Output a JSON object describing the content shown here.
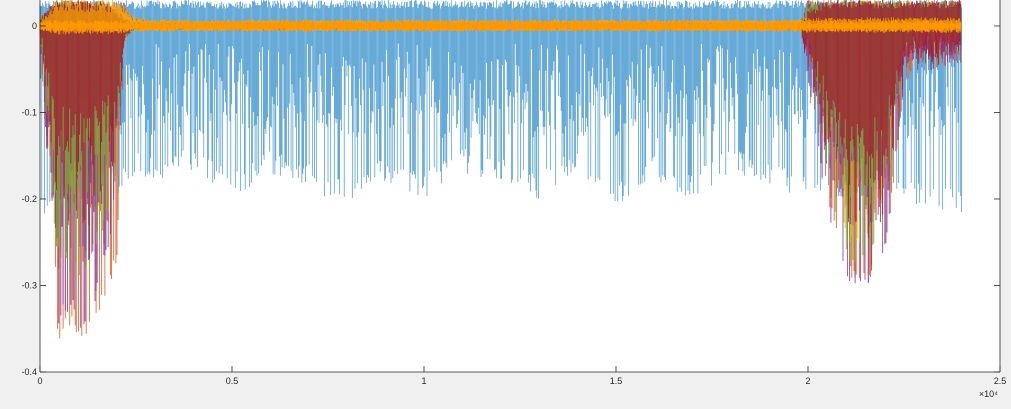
{
  "chart_data": {
    "type": "line",
    "title": "",
    "xlabel": "",
    "ylabel": "",
    "xlim": [
      0,
      25000
    ],
    "ylim": [
      -0.4,
      0.03
    ],
    "x_ticks": [
      {
        "value": 0,
        "label": "0"
      },
      {
        "value": 5000,
        "label": "0.5"
      },
      {
        "value": 10000,
        "label": "1"
      },
      {
        "value": 15000,
        "label": "1.5"
      },
      {
        "value": 20000,
        "label": "2"
      },
      {
        "value": 25000,
        "label": "2.5"
      }
    ],
    "x_exponent_label": "×10⁴",
    "y_ticks": [
      {
        "value": 0,
        "label": "0"
      },
      {
        "value": -0.1,
        "label": "-0.1"
      },
      {
        "value": -0.2,
        "label": "-0.2"
      },
      {
        "value": -0.3,
        "label": "-0.3"
      },
      {
        "value": -0.4,
        "label": "-0.4"
      }
    ],
    "grid": false,
    "legend": "none",
    "series": [
      {
        "color": "#0072bd",
        "x": [
          0,
          500,
          1000,
          1500,
          2000,
          2500,
          3000,
          4000,
          5000,
          6000,
          7000,
          8000,
          9000,
          10000,
          11000,
          12000,
          13000,
          14000,
          15000,
          16000,
          17000,
          18000,
          19000,
          20000,
          21000,
          22000,
          23000,
          24000
        ],
        "upper": [
          0.03,
          0.03,
          0.03,
          0.03,
          0.03,
          0.03,
          0.03,
          0.03,
          0.03,
          0.03,
          0.03,
          0.03,
          0.03,
          0.03,
          0.03,
          0.03,
          0.03,
          0.03,
          0.03,
          0.03,
          0.03,
          0.03,
          0.03,
          0.03,
          0.03,
          0.03,
          0.03,
          0.03
        ],
        "lower": [
          -0.23,
          -0.2,
          -0.17,
          -0.18,
          -0.2,
          -0.17,
          -0.18,
          -0.17,
          -0.2,
          -0.17,
          -0.19,
          -0.21,
          -0.18,
          -0.2,
          -0.17,
          -0.18,
          -0.2,
          -0.17,
          -0.21,
          -0.18,
          -0.2,
          -0.17,
          -0.19,
          -0.2,
          -0.21,
          -0.2,
          -0.21,
          -0.22
        ]
      },
      {
        "color": "#d95319",
        "x": [
          0,
          400,
          800,
          1200,
          1600,
          2000,
          2200,
          2400,
          3000,
          5000,
          8000,
          11000,
          14000,
          17000,
          19800,
          20000,
          20500,
          21000,
          21500,
          22000,
          22500,
          23000,
          23500,
          24000
        ],
        "upper": [
          0.01,
          0.03,
          0.03,
          0.03,
          0.03,
          0.03,
          0.03,
          0.01,
          0.005,
          0.005,
          0.005,
          0.005,
          0.005,
          0.005,
          0.005,
          0.03,
          0.03,
          0.03,
          0.03,
          0.03,
          0.03,
          0.03,
          0.03,
          0.03
        ],
        "lower": [
          -0.01,
          -0.37,
          -0.35,
          -0.37,
          -0.33,
          -0.28,
          -0.02,
          -0.005,
          -0.005,
          -0.005,
          -0.005,
          -0.005,
          -0.005,
          -0.005,
          -0.005,
          -0.05,
          -0.2,
          -0.29,
          -0.3,
          -0.28,
          -0.08,
          -0.05,
          -0.05,
          -0.05
        ]
      },
      {
        "color": "#edb120",
        "x": [
          0,
          400,
          800,
          1200,
          1600,
          2000,
          2200,
          2400,
          3000,
          5000,
          8000,
          11000,
          14000,
          17000,
          19800,
          20000,
          20500,
          21000,
          21500,
          22000,
          22500,
          23000,
          23500,
          24000
        ],
        "upper": [
          0.01,
          0.03,
          0.03,
          0.03,
          0.03,
          0.03,
          0.02,
          0.01,
          0.006,
          0.006,
          0.006,
          0.006,
          0.006,
          0.006,
          0.006,
          0.02,
          0.03,
          0.03,
          0.03,
          0.03,
          0.03,
          0.03,
          0.03,
          0.03
        ],
        "lower": [
          -0.01,
          -0.3,
          -0.2,
          -0.25,
          -0.22,
          -0.15,
          -0.02,
          -0.006,
          -0.006,
          -0.006,
          -0.006,
          -0.006,
          -0.006,
          -0.006,
          -0.006,
          -0.04,
          -0.15,
          -0.25,
          -0.26,
          -0.2,
          -0.06,
          -0.04,
          -0.04,
          -0.04
        ]
      },
      {
        "color": "#7e2f8e",
        "x": [
          0,
          400,
          800,
          1200,
          1600,
          2000,
          2200,
          2400,
          3000,
          8000,
          14000,
          19800,
          20000,
          20500,
          21000,
          21500,
          22000,
          22500,
          23000,
          24000
        ],
        "upper": [
          0.01,
          0.03,
          0.03,
          0.03,
          0.03,
          0.02,
          0.01,
          0.005,
          0.004,
          0.004,
          0.004,
          0.004,
          0.03,
          0.03,
          0.03,
          0.03,
          0.03,
          0.03,
          0.03,
          0.03
        ],
        "lower": [
          -0.01,
          -0.35,
          -0.33,
          -0.36,
          -0.3,
          -0.2,
          -0.02,
          -0.005,
          -0.004,
          -0.004,
          -0.004,
          -0.004,
          -0.06,
          -0.22,
          -0.3,
          -0.31,
          -0.27,
          -0.07,
          -0.05,
          -0.06
        ]
      },
      {
        "color": "#77ac30",
        "x": [
          0,
          400,
          800,
          1200,
          1600,
          2000,
          2200,
          2400,
          3000,
          8000,
          14000,
          19800,
          20000,
          20500,
          21000,
          21500,
          22000,
          22500,
          23000,
          24000
        ],
        "upper": [
          0.01,
          0.03,
          0.03,
          0.03,
          0.03,
          0.02,
          0.01,
          0.004,
          0.003,
          0.003,
          0.003,
          0.003,
          0.03,
          0.03,
          0.03,
          0.03,
          0.03,
          0.03,
          0.03,
          0.03
        ],
        "lower": [
          -0.01,
          -0.25,
          -0.3,
          -0.28,
          -0.25,
          -0.18,
          -0.02,
          -0.004,
          -0.003,
          -0.003,
          -0.003,
          -0.003,
          -0.03,
          -0.18,
          -0.27,
          -0.28,
          -0.26,
          -0.04,
          -0.03,
          -0.03
        ]
      },
      {
        "color": "#a2142f",
        "x": [
          0,
          400,
          800,
          1200,
          1600,
          2000,
          2200,
          2400,
          3000,
          8000,
          14000,
          19800,
          20000,
          20500,
          21000,
          21500,
          22000,
          22500,
          23000,
          24000
        ],
        "upper": [
          0.01,
          0.03,
          0.03,
          0.03,
          0.03,
          0.02,
          0.01,
          0.004,
          0.003,
          0.003,
          0.003,
          0.003,
          0.02,
          0.03,
          0.03,
          0.03,
          0.03,
          0.03,
          0.03,
          0.03
        ],
        "lower": [
          -0.01,
          -0.2,
          -0.22,
          -0.23,
          -0.2,
          -0.15,
          -0.02,
          -0.004,
          -0.003,
          -0.003,
          -0.003,
          -0.003,
          -0.05,
          -0.16,
          -0.24,
          -0.25,
          -0.22,
          -0.06,
          -0.05,
          -0.06
        ]
      },
      {
        "color": "#ffa500",
        "x": [
          0,
          400,
          800,
          1200,
          1600,
          2000,
          2200,
          2400,
          3000,
          5000,
          8000,
          11000,
          14000,
          17000,
          19800,
          20000,
          21000,
          22000,
          23000,
          24000
        ],
        "upper": [
          0.005,
          0.03,
          0.03,
          0.03,
          0.03,
          0.03,
          0.025,
          0.012,
          0.008,
          0.008,
          0.008,
          0.008,
          0.008,
          0.008,
          0.008,
          0.01,
          0.01,
          0.01,
          0.01,
          0.01
        ],
        "lower": [
          -0.005,
          -0.01,
          -0.01,
          -0.01,
          -0.01,
          -0.01,
          -0.008,
          -0.006,
          -0.006,
          -0.006,
          -0.006,
          -0.006,
          -0.006,
          -0.006,
          -0.006,
          -0.008,
          -0.008,
          -0.008,
          -0.008,
          -0.008
        ]
      }
    ]
  }
}
